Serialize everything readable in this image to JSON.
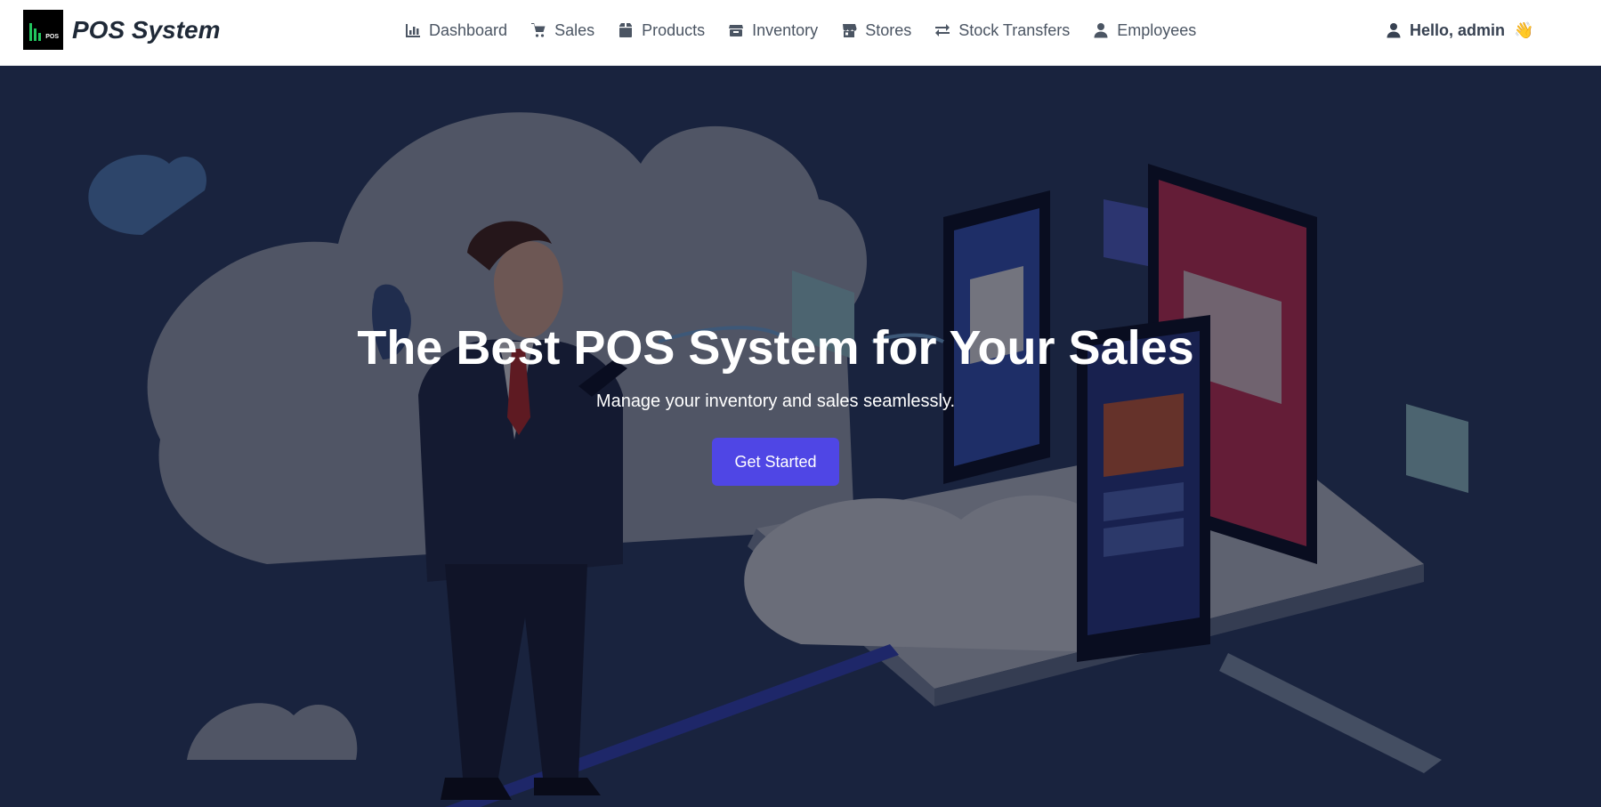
{
  "brand": {
    "logo_text": "POS",
    "name": "POS System"
  },
  "nav": [
    {
      "label": "Dashboard",
      "icon": "chart-bar-icon"
    },
    {
      "label": "Sales",
      "icon": "cart-icon"
    },
    {
      "label": "Products",
      "icon": "box-icon"
    },
    {
      "label": "Inventory",
      "icon": "inventory-icon"
    },
    {
      "label": "Stores",
      "icon": "store-icon"
    },
    {
      "label": "Stock Transfers",
      "icon": "transfer-arrows-icon"
    },
    {
      "label": "Employees",
      "icon": "user-icon"
    }
  ],
  "user": {
    "greeting": "Hello, admin",
    "emoji": "👋",
    "icon": "user-icon"
  },
  "hero": {
    "title": "The Best POS System for Your Sales",
    "subtitle": "Manage your inventory and sales seamlessly.",
    "cta_label": "Get Started",
    "illustration": "businessman-with-phone-and-cloud-devices-illustration"
  },
  "colors": {
    "accent": "#4f46e5",
    "nav_text": "#4b5563",
    "hero_overlay": "#080a1c"
  }
}
